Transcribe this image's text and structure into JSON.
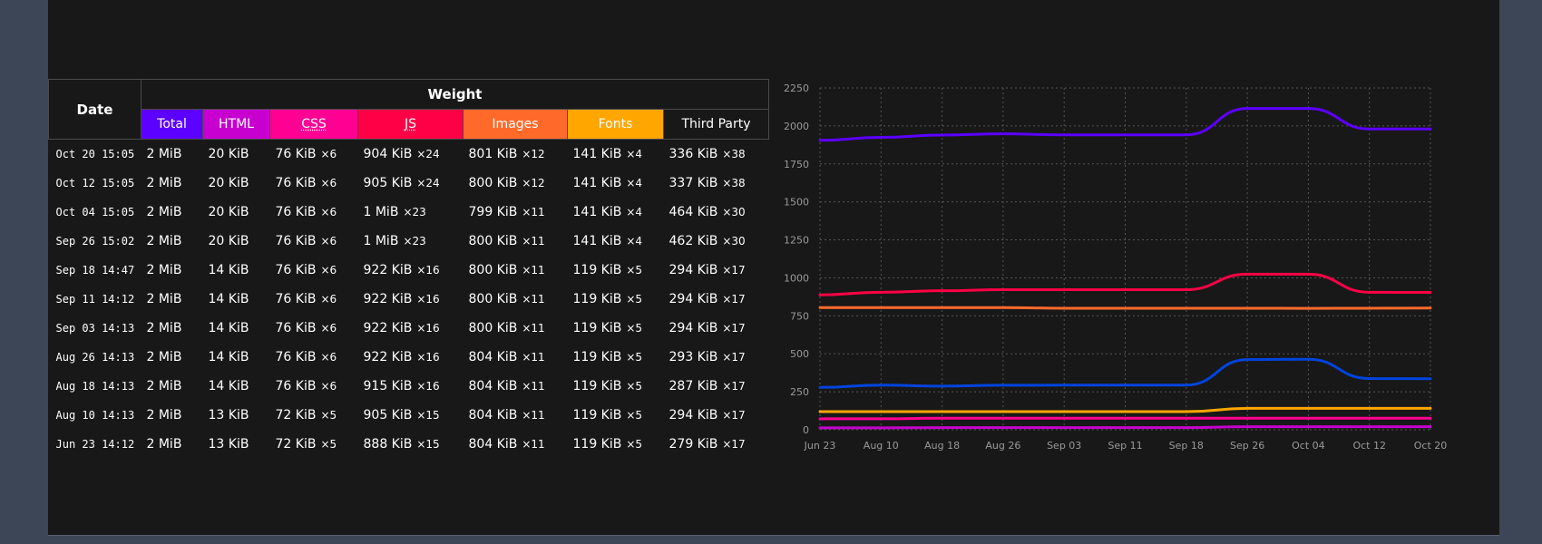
{
  "table": {
    "date_header": "Date",
    "weight_header": "Weight",
    "columns": [
      {
        "label": "Total",
        "color": "#5c00ff",
        "abbr": false
      },
      {
        "label": "HTML",
        "color": "#c700d0",
        "abbr": false
      },
      {
        "label": "CSS",
        "color": "#ff0093",
        "abbr": true
      },
      {
        "label": "JS",
        "color": "#ff0046",
        "abbr": true
      },
      {
        "label": "Images",
        "color": "#ff6a2b",
        "abbr": false
      },
      {
        "label": "Fonts",
        "color": "#ffa600",
        "abbr": false
      },
      {
        "label": "Third Party",
        "color": "#181818",
        "abbr": false
      }
    ],
    "rows": [
      {
        "date": "Oct 20 15:05",
        "cells": [
          [
            "2 MiB",
            ""
          ],
          [
            "20 KiB",
            ""
          ],
          [
            "76 KiB",
            "×6"
          ],
          [
            "904 KiB",
            "×24"
          ],
          [
            "801 KiB",
            "×12"
          ],
          [
            "141 KiB",
            "×4"
          ],
          [
            "336 KiB",
            "×38"
          ]
        ]
      },
      {
        "date": "Oct 12 15:05",
        "cells": [
          [
            "2 MiB",
            ""
          ],
          [
            "20 KiB",
            ""
          ],
          [
            "76 KiB",
            "×6"
          ],
          [
            "905 KiB",
            "×24"
          ],
          [
            "800 KiB",
            "×12"
          ],
          [
            "141 KiB",
            "×4"
          ],
          [
            "337 KiB",
            "×38"
          ]
        ]
      },
      {
        "date": "Oct 04 15:05",
        "cells": [
          [
            "2 MiB",
            ""
          ],
          [
            "20 KiB",
            ""
          ],
          [
            "76 KiB",
            "×6"
          ],
          [
            "1 MiB",
            "×23"
          ],
          [
            "799 KiB",
            "×11"
          ],
          [
            "141 KiB",
            "×4"
          ],
          [
            "464 KiB",
            "×30"
          ]
        ]
      },
      {
        "date": "Sep 26 15:02",
        "cells": [
          [
            "2 MiB",
            ""
          ],
          [
            "20 KiB",
            ""
          ],
          [
            "76 KiB",
            "×6"
          ],
          [
            "1 MiB",
            "×23"
          ],
          [
            "800 KiB",
            "×11"
          ],
          [
            "141 KiB",
            "×4"
          ],
          [
            "462 KiB",
            "×30"
          ]
        ]
      },
      {
        "date": "Sep 18 14:47",
        "cells": [
          [
            "2 MiB",
            ""
          ],
          [
            "14 KiB",
            ""
          ],
          [
            "76 KiB",
            "×6"
          ],
          [
            "922 KiB",
            "×16"
          ],
          [
            "800 KiB",
            "×11"
          ],
          [
            "119 KiB",
            "×5"
          ],
          [
            "294 KiB",
            "×17"
          ]
        ]
      },
      {
        "date": "Sep 11 14:12",
        "cells": [
          [
            "2 MiB",
            ""
          ],
          [
            "14 KiB",
            ""
          ],
          [
            "76 KiB",
            "×6"
          ],
          [
            "922 KiB",
            "×16"
          ],
          [
            "800 KiB",
            "×11"
          ],
          [
            "119 KiB",
            "×5"
          ],
          [
            "294 KiB",
            "×17"
          ]
        ]
      },
      {
        "date": "Sep 03 14:13",
        "cells": [
          [
            "2 MiB",
            ""
          ],
          [
            "14 KiB",
            ""
          ],
          [
            "76 KiB",
            "×6"
          ],
          [
            "922 KiB",
            "×16"
          ],
          [
            "800 KiB",
            "×11"
          ],
          [
            "119 KiB",
            "×5"
          ],
          [
            "294 KiB",
            "×17"
          ]
        ]
      },
      {
        "date": "Aug 26 14:13",
        "cells": [
          [
            "2 MiB",
            ""
          ],
          [
            "14 KiB",
            ""
          ],
          [
            "76 KiB",
            "×6"
          ],
          [
            "922 KiB",
            "×16"
          ],
          [
            "804 KiB",
            "×11"
          ],
          [
            "119 KiB",
            "×5"
          ],
          [
            "293 KiB",
            "×17"
          ]
        ]
      },
      {
        "date": "Aug 18 14:13",
        "cells": [
          [
            "2 MiB",
            ""
          ],
          [
            "14 KiB",
            ""
          ],
          [
            "76 KiB",
            "×6"
          ],
          [
            "915 KiB",
            "×16"
          ],
          [
            "804 KiB",
            "×11"
          ],
          [
            "119 KiB",
            "×5"
          ],
          [
            "287 KiB",
            "×17"
          ]
        ]
      },
      {
        "date": "Aug 10 14:13",
        "cells": [
          [
            "2 MiB",
            ""
          ],
          [
            "13 KiB",
            ""
          ],
          [
            "72 KiB",
            "×5"
          ],
          [
            "905 KiB",
            "×15"
          ],
          [
            "804 KiB",
            "×11"
          ],
          [
            "119 KiB",
            "×5"
          ],
          [
            "294 KiB",
            "×17"
          ]
        ]
      },
      {
        "date": "Jun 23 14:12",
        "cells": [
          [
            "2 MiB",
            ""
          ],
          [
            "13 KiB",
            ""
          ],
          [
            "72 KiB",
            "×5"
          ],
          [
            "888 KiB",
            "×15"
          ],
          [
            "804 KiB",
            "×11"
          ],
          [
            "119 KiB",
            "×5"
          ],
          [
            "279 KiB",
            "×17"
          ]
        ]
      }
    ]
  },
  "chart_data": {
    "type": "line",
    "x": [
      "Jun 23",
      "Aug 10",
      "Aug 18",
      "Aug 26",
      "Sep 03",
      "Sep 11",
      "Sep 18",
      "Sep 26",
      "Oct 04",
      "Oct 12",
      "Oct 20"
    ],
    "ylim": [
      0,
      2250
    ],
    "yticks": [
      0,
      250,
      500,
      750,
      1000,
      1250,
      1500,
      1750,
      2000,
      2250
    ],
    "grid": true,
    "series": [
      {
        "color": "#5c00ff",
        "values": [
          1905,
          1925,
          1940,
          1948,
          1941,
          1941,
          1941,
          2115,
          2115,
          1980,
          1980
        ]
      },
      {
        "color": "#c700d0",
        "values": [
          13,
          13,
          14,
          14,
          14,
          14,
          14,
          20,
          20,
          20,
          20
        ]
      },
      {
        "color": "#ff0093",
        "values": [
          72,
          72,
          76,
          76,
          76,
          76,
          76,
          76,
          76,
          76,
          76
        ]
      },
      {
        "color": "#ff0046",
        "values": [
          888,
          905,
          915,
          922,
          922,
          922,
          922,
          1024,
          1024,
          905,
          904
        ]
      },
      {
        "color": "#ff6a2b",
        "values": [
          804,
          804,
          804,
          804,
          800,
          800,
          800,
          800,
          799,
          800,
          801
        ]
      },
      {
        "color": "#ffa600",
        "values": [
          119,
          119,
          119,
          119,
          119,
          119,
          119,
          141,
          141,
          141,
          141
        ]
      },
      {
        "color": "#0044dd",
        "values": [
          279,
          294,
          287,
          293,
          294,
          294,
          294,
          462,
          464,
          337,
          336
        ]
      }
    ]
  }
}
